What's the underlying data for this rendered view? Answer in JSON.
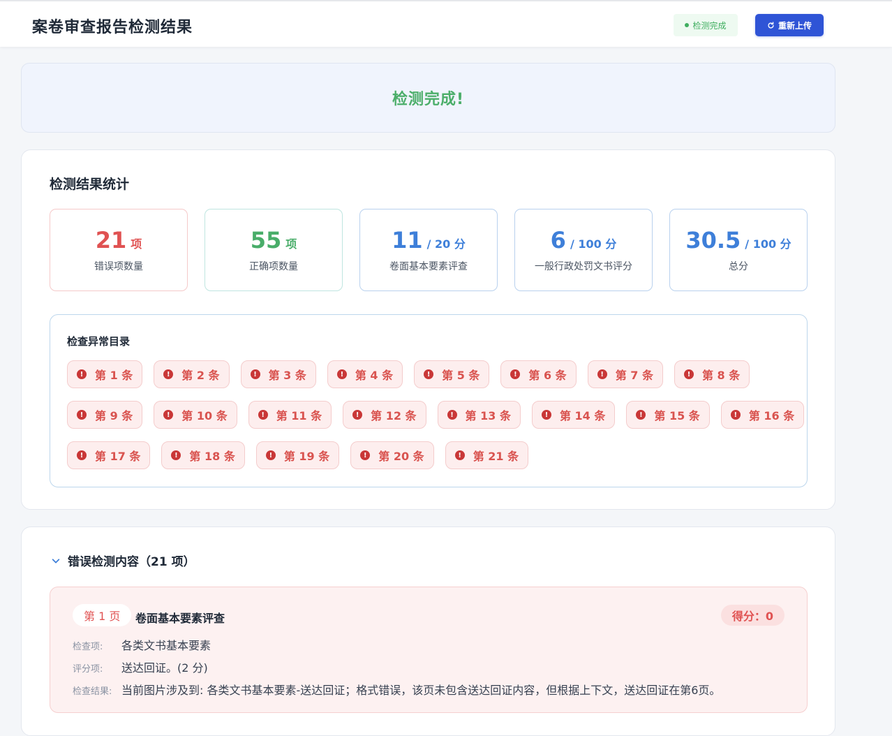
{
  "header": {
    "title": "案卷审查报告检测结果",
    "status": "检测完成",
    "reupload_label": "重新上传"
  },
  "banner": {
    "text": "检测完成!"
  },
  "stats": {
    "title": "检测结果统计",
    "items": [
      {
        "value": "21",
        "unit": "项",
        "label": "错误项数量",
        "color": "#e05252"
      },
      {
        "value": "55",
        "unit": "项",
        "label": "正确项数量",
        "color": "#49ad69"
      },
      {
        "value": "11",
        "unit": "/ 20 分",
        "label": "卷面基本要素评查",
        "color": "#3e7fd9"
      },
      {
        "value": "6",
        "unit": "/ 100 分",
        "label": "一般行政处罚文书评分",
        "color": "#3e7fd9"
      },
      {
        "value": "30.5",
        "unit": "/ 100 分",
        "label": "总分",
        "color": "#3e7fd9"
      }
    ]
  },
  "anomalies": {
    "title": "检查异常目录",
    "items": [
      "第 1 条",
      "第 2 条",
      "第 3 条",
      "第 4 条",
      "第 5 条",
      "第 6 条",
      "第 7 条",
      "第 8 条",
      "第 9 条",
      "第 10 条",
      "第 11 条",
      "第 12 条",
      "第 13 条",
      "第 14 条",
      "第 15 条",
      "第 16 条",
      "第 17 条",
      "第 18 条",
      "第 19 条",
      "第 20 条",
      "第 21 条"
    ]
  },
  "errors": {
    "title": "错误检测内容（21 项）",
    "items": [
      {
        "page": "第 1 页",
        "category": "卷面基本要素评查",
        "score": "得分：0",
        "check_item_label": "检查项:",
        "check_item": "各类文书基本要素",
        "score_item_label": "评分项:",
        "score_item": "送达回证。(2 分)",
        "result_label": "检查结果:",
        "result": "当前图片涉及到: 各类文书基本要素-送达回证；格式错误，该页未包含送达回证内容，但根据上下文，送达回证在第6页。"
      }
    ]
  }
}
